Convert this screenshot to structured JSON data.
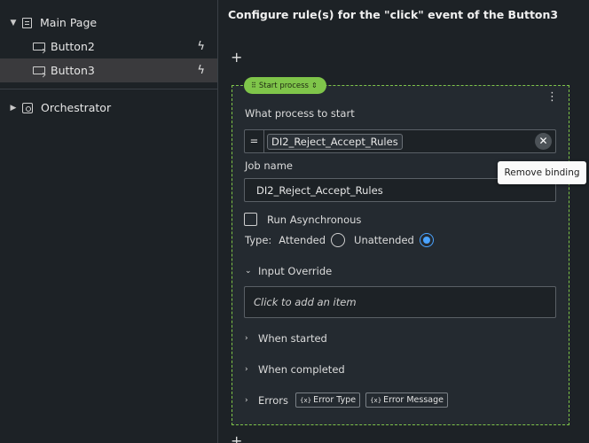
{
  "tree": {
    "main_page": "Main Page",
    "button2": "Button2",
    "button3": "Button3",
    "orchestrator": "Orchestrator"
  },
  "header": {
    "title": "Configure rule(s) for the \"click\" event of the Button3",
    "add": "+"
  },
  "card": {
    "chip_label": "Start process",
    "process_label": "What process to start",
    "eq": "=",
    "process_value": "DI2_Reject_Accept_Rules",
    "tooltip": "Remove binding",
    "job_label": "Job name",
    "job_value": "DI2_Reject_Accept_Rules",
    "run_async": "Run Asynchronous",
    "type_label": "Type:",
    "attended": "Attended",
    "unattended": "Unattended",
    "selected_type": "Unattended",
    "input_override": "Input Override",
    "add_item_placeholder": "Click to add an item",
    "when_started": "When started",
    "when_completed": "When completed",
    "errors": "Errors",
    "error_type": "Error Type",
    "error_message": "Error Message"
  },
  "colors": {
    "accent": "#7fc54a",
    "radio": "#4aa3ff"
  }
}
